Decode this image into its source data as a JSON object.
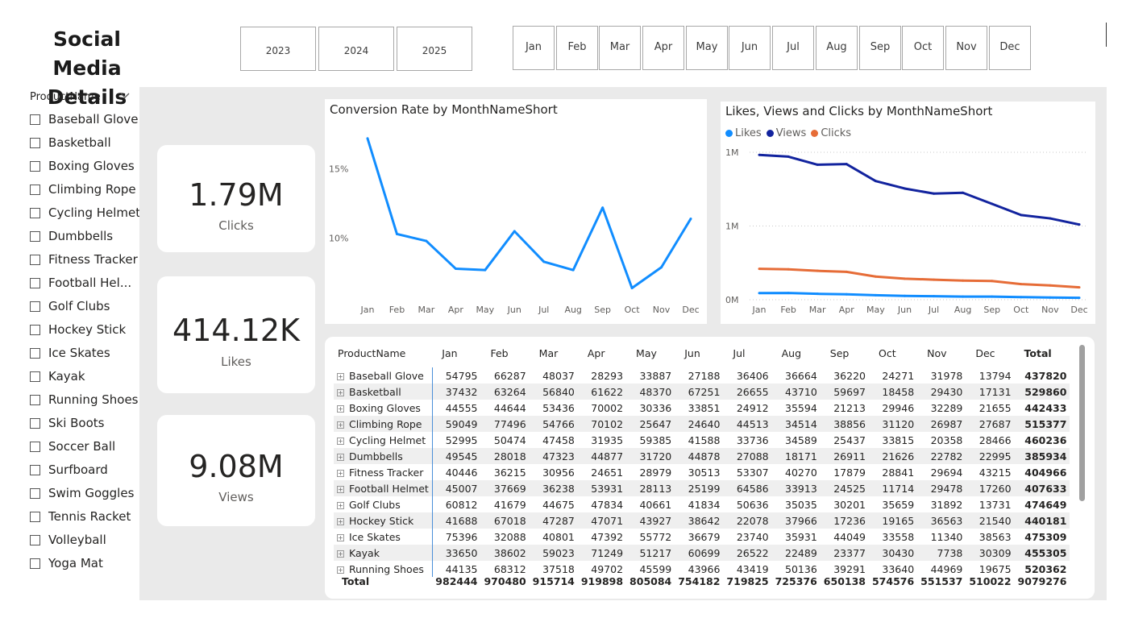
{
  "page_title": {
    "line1": "Social Media",
    "line2": "Details"
  },
  "year_slicer": {
    "items": [
      "2023",
      "2024",
      "2025"
    ]
  },
  "month_slicer": {
    "items": [
      "Jan",
      "Feb",
      "Mar",
      "Apr",
      "May",
      "Jun",
      "Jul",
      "Aug",
      "Sep",
      "Oct",
      "Nov",
      "Dec"
    ]
  },
  "product_slicer": {
    "header": "ProductName",
    "items": [
      "Baseball Glove",
      "Basketball",
      "Boxing Gloves",
      "Climbing Rope",
      "Cycling Helmet",
      "Dumbbells",
      "Fitness Tracker",
      "Football Hel...",
      "Golf Clubs",
      "Hockey Stick",
      "Ice Skates",
      "Kayak",
      "Running Shoes",
      "Ski Boots",
      "Soccer Ball",
      "Surfboard",
      "Swim Goggles",
      "Tennis Racket",
      "Volleyball",
      "Yoga Mat"
    ]
  },
  "cards": [
    {
      "value": "1.79M",
      "label": "Clicks"
    },
    {
      "value": "414.12K",
      "label": "Likes"
    },
    {
      "value": "9.08M",
      "label": "Views"
    }
  ],
  "conversion_chart": {
    "title": "Conversion Rate by MonthNameShort",
    "y_ticks": [
      "15%",
      "10%"
    ]
  },
  "lvc_chart": {
    "title": "Likes, Views and Clicks by MonthNameShort",
    "legend": [
      "Likes",
      "Views",
      "Clicks"
    ],
    "y_ticks": [
      "1M",
      "1M",
      "0M"
    ]
  },
  "colors": {
    "likes": "#118DFF",
    "views": "#12239E",
    "clicks": "#E66C37",
    "conversion": "#118DFF"
  },
  "chart_data": [
    {
      "type": "line",
      "title": "Conversion Rate by MonthNameShort",
      "x": [
        "Jan",
        "Feb",
        "Mar",
        "Apr",
        "May",
        "Jun",
        "Jul",
        "Aug",
        "Sep",
        "Oct",
        "Nov",
        "Dec"
      ],
      "series": [
        {
          "name": "",
          "values": [
            17.2,
            10.3,
            9.8,
            7.8,
            7.7,
            10.5,
            8.3,
            7.7,
            12.2,
            6.4,
            7.9,
            11.4
          ]
        }
      ],
      "ylim": [
        5.5,
        18
      ],
      "ylabel_ticks": [
        15,
        10
      ],
      "grid": false
    },
    {
      "type": "line",
      "title": "Likes, Views and Clicks by MonthNameShort",
      "x": [
        "Jan",
        "Feb",
        "Mar",
        "Apr",
        "May",
        "Jun",
        "Jul",
        "Aug",
        "Sep",
        "Oct",
        "Nov",
        "Dec"
      ],
      "series": [
        {
          "name": "Likes",
          "values": [
            45000,
            46000,
            40000,
            37000,
            31000,
            26000,
            24000,
            21000,
            21000,
            18000,
            15000,
            13000
          ]
        },
        {
          "name": "Views",
          "values": [
            982444,
            970480,
            915714,
            919898,
            805084,
            754182,
            719825,
            725376,
            650138,
            574576,
            551537,
            510022
          ]
        },
        {
          "name": "Clicks",
          "values": [
            210000,
            206000,
            196000,
            189000,
            157000,
            143000,
            136000,
            130000,
            127000,
            106000,
            97000,
            84000
          ]
        }
      ],
      "ylim": [
        0,
        1000000
      ],
      "legend_position": "top-left",
      "grid": true
    }
  ],
  "matrix": {
    "header_label": "ProductName",
    "columns": [
      "Jan",
      "Feb",
      "Mar",
      "Apr",
      "May",
      "Jun",
      "Jul",
      "Aug",
      "Sep",
      "Oct",
      "Nov",
      "Dec",
      "Total"
    ],
    "rows": [
      {
        "name": "Baseball Glove",
        "values": [
          "54795",
          "66287",
          "48037",
          "28293",
          "33887",
          "27188",
          "36406",
          "36664",
          "36220",
          "24271",
          "31978",
          "13794",
          "437820"
        ]
      },
      {
        "name": "Basketball",
        "values": [
          "37432",
          "63264",
          "56840",
          "61622",
          "48370",
          "67251",
          "26655",
          "43710",
          "59697",
          "18458",
          "29430",
          "17131",
          "529860"
        ]
      },
      {
        "name": "Boxing Gloves",
        "values": [
          "44555",
          "44644",
          "53436",
          "70002",
          "30336",
          "33851",
          "24912",
          "35594",
          "21213",
          "29946",
          "32289",
          "21655",
          "442433"
        ]
      },
      {
        "name": "Climbing Rope",
        "values": [
          "59049",
          "77496",
          "54766",
          "70102",
          "25647",
          "24640",
          "44513",
          "34514",
          "38856",
          "31120",
          "26987",
          "27687",
          "515377"
        ]
      },
      {
        "name": "Cycling Helmet",
        "values": [
          "52995",
          "50474",
          "47458",
          "31935",
          "59385",
          "41588",
          "33736",
          "34589",
          "25437",
          "33815",
          "20358",
          "28466",
          "460236"
        ]
      },
      {
        "name": "Dumbbells",
        "values": [
          "49545",
          "28018",
          "47323",
          "44877",
          "31720",
          "44878",
          "27088",
          "18171",
          "26911",
          "21626",
          "22782",
          "22995",
          "385934"
        ]
      },
      {
        "name": "Fitness Tracker",
        "values": [
          "40446",
          "36215",
          "30956",
          "24651",
          "28979",
          "30513",
          "53307",
          "40270",
          "17879",
          "28841",
          "29694",
          "43215",
          "404966"
        ]
      },
      {
        "name": "Football Helmet",
        "values": [
          "45007",
          "37669",
          "36238",
          "53931",
          "28113",
          "25199",
          "64586",
          "33913",
          "24525",
          "11714",
          "29478",
          "17260",
          "407633"
        ]
      },
      {
        "name": "Golf Clubs",
        "values": [
          "60812",
          "41679",
          "44675",
          "47834",
          "40661",
          "41834",
          "50636",
          "35035",
          "30201",
          "35659",
          "31892",
          "13731",
          "474649"
        ]
      },
      {
        "name": "Hockey Stick",
        "values": [
          "41688",
          "67018",
          "47287",
          "47071",
          "43927",
          "38642",
          "22078",
          "37966",
          "17236",
          "19165",
          "36563",
          "21540",
          "440181"
        ]
      },
      {
        "name": "Ice Skates",
        "values": [
          "75396",
          "32088",
          "40801",
          "47392",
          "55772",
          "36679",
          "23740",
          "35931",
          "44049",
          "33558",
          "11340",
          "38563",
          "475309"
        ]
      },
      {
        "name": "Kayak",
        "values": [
          "33650",
          "38602",
          "59023",
          "71249",
          "51217",
          "60699",
          "26522",
          "22489",
          "23377",
          "30430",
          "7738",
          "30309",
          "455305"
        ]
      },
      {
        "name": "Running Shoes",
        "values": [
          "44135",
          "68312",
          "37518",
          "49702",
          "45599",
          "43966",
          "43419",
          "50136",
          "39291",
          "33640",
          "44969",
          "19675",
          "520362"
        ]
      }
    ],
    "total": {
      "name": "Total",
      "values": [
        "982444",
        "970480",
        "915714",
        "919898",
        "805084",
        "754182",
        "719825",
        "725376",
        "650138",
        "574576",
        "551537",
        "510022",
        "9079276"
      ]
    }
  }
}
